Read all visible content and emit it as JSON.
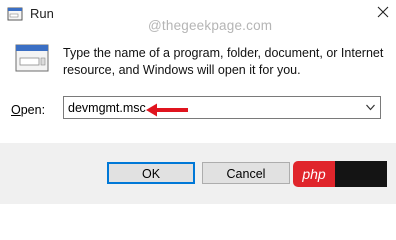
{
  "window": {
    "title": "Run",
    "close_glyph": "✕"
  },
  "watermark": "@thegeekpage.com",
  "dialog": {
    "description": "Type the name of a program, folder, document, or Internet resource, and Windows will open it for you.",
    "open_label_mnemonic": "O",
    "open_label_rest": "pen:",
    "input_value": "devmgmt.msc"
  },
  "buttons": {
    "ok": "OK",
    "cancel": "Cancel",
    "browse": ""
  },
  "overlay": {
    "php_logo": "php"
  },
  "colors": {
    "annotation_arrow": "#e0141e",
    "focus_border": "#0078d7"
  },
  "icons": {
    "title": "run-icon",
    "close": "close-icon",
    "dropdown": "chevron-down-icon",
    "annotation": "red-arrow-icon"
  }
}
